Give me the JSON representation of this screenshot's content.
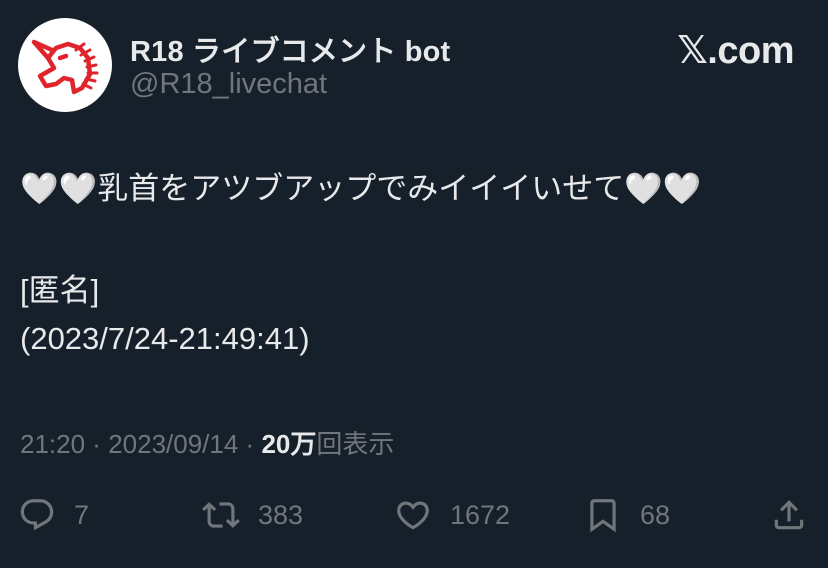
{
  "author": {
    "display_name": "R18 ライブコメント bot",
    "handle": "@R18_livechat"
  },
  "brand": "𝕏.com",
  "tweet": {
    "line1": "🤍🤍乳首をアツブアップでみイイイいせて🤍🤍",
    "line2": "[匿名]",
    "line3": "(2023/7/24-21:49:41)"
  },
  "meta": {
    "time": "21:20",
    "separator1": " · ",
    "date": "2023/09/14",
    "separator2": " · ",
    "views_count": "20万",
    "views_label": "回表示"
  },
  "actions": {
    "reply_count": "7",
    "repost_count": "383",
    "like_count": "1672",
    "bookmark_count": "68"
  },
  "icons": {
    "avatar": "unicorn-logo-icon",
    "reply": "reply-icon",
    "repost": "repost-icon",
    "like": "heart-icon",
    "bookmark": "bookmark-icon",
    "share": "share-icon"
  },
  "colors": {
    "background": "#16202a",
    "text": "#e7e9ea",
    "muted": "#71767b",
    "logo_red": "#e0242b"
  }
}
